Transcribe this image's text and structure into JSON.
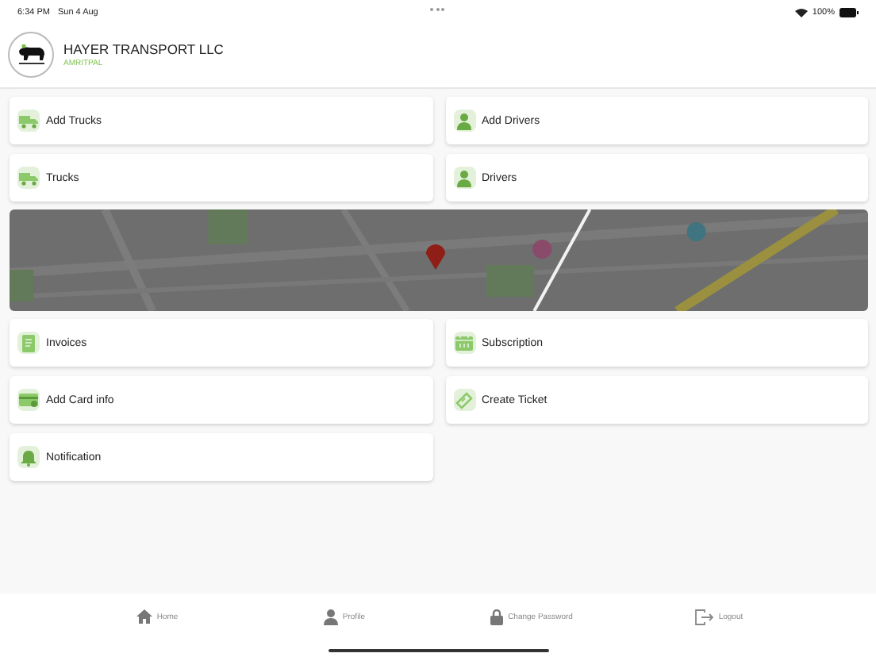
{
  "status_bar": {
    "time": "6:34 PM",
    "date": "Sun 4 Aug",
    "battery": "100%"
  },
  "header": {
    "company": "HAYER TRANSPORT LLC",
    "user": "AMRITPAL"
  },
  "menu_top": [
    {
      "label": "Add Trucks",
      "kind": "truck"
    },
    {
      "label": "Add Drivers",
      "kind": "driver"
    },
    {
      "label": "Trucks",
      "kind": "truck"
    },
    {
      "label": "Drivers",
      "kind": "driver"
    }
  ],
  "menu_bottom": [
    {
      "label": "Invoices",
      "kind": "invoice"
    },
    {
      "label": "Subscription",
      "kind": "calendar"
    },
    {
      "label": "Add Card info",
      "kind": "card"
    },
    {
      "label": "Create Ticket",
      "kind": "ticket"
    },
    {
      "label": "Notification",
      "kind": "bell"
    }
  ],
  "tab_bar": [
    {
      "label": "Home",
      "kind": "home"
    },
    {
      "label": "Profile",
      "kind": "person"
    },
    {
      "label": "Change Password",
      "kind": "lock"
    },
    {
      "label": "Logout",
      "kind": "logout"
    }
  ]
}
